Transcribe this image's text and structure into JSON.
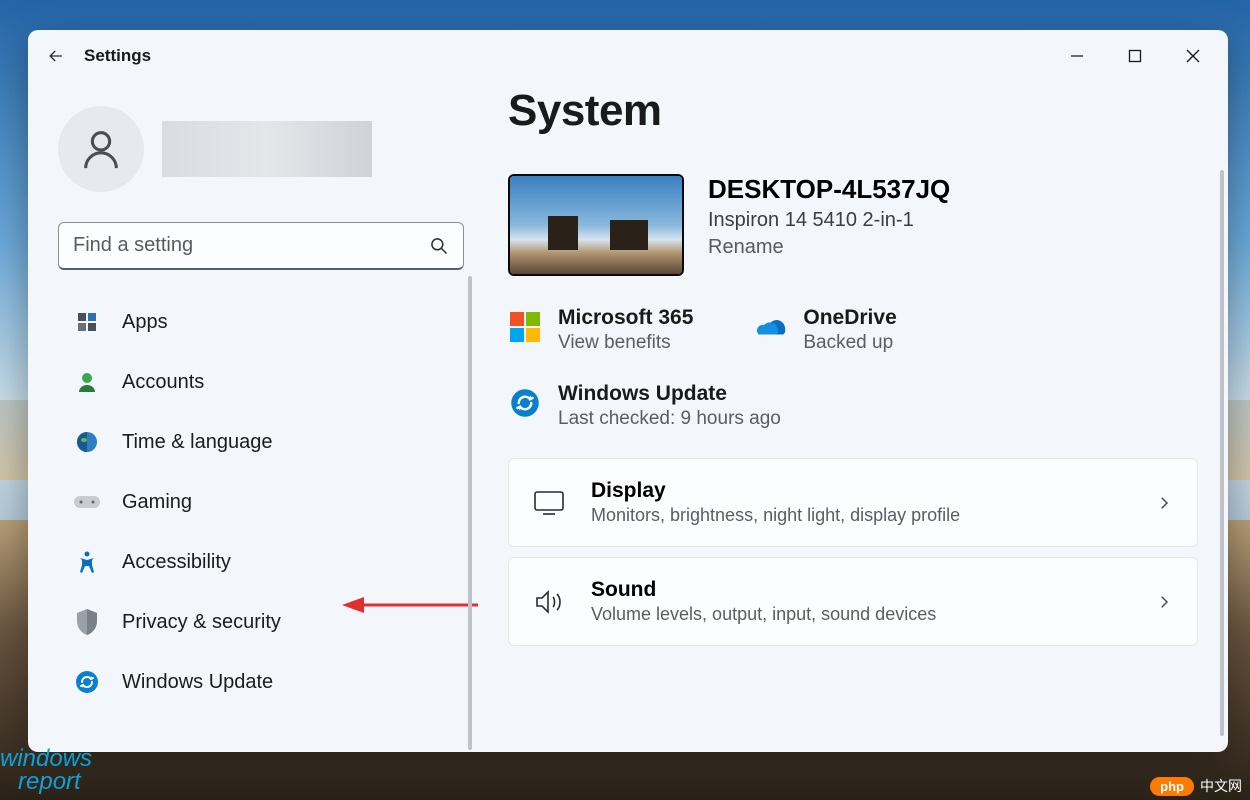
{
  "titlebar": {
    "title": "Settings"
  },
  "search": {
    "placeholder": "Find a setting"
  },
  "sidebar": {
    "items": [
      {
        "label": "Apps",
        "icon": "apps-icon"
      },
      {
        "label": "Accounts",
        "icon": "accounts-icon"
      },
      {
        "label": "Time & language",
        "icon": "time-language-icon"
      },
      {
        "label": "Gaming",
        "icon": "gaming-icon"
      },
      {
        "label": "Accessibility",
        "icon": "accessibility-icon"
      },
      {
        "label": "Privacy & security",
        "icon": "privacy-security-icon"
      },
      {
        "label": "Windows Update",
        "icon": "windows-update-icon"
      }
    ]
  },
  "main": {
    "title": "System",
    "device": {
      "name": "DESKTOP-4L537JQ",
      "model": "Inspiron 14 5410 2-in-1",
      "rename": "Rename"
    },
    "cards": {
      "ms365": {
        "title": "Microsoft 365",
        "sub": "View benefits"
      },
      "onedrive": {
        "title": "OneDrive",
        "sub": "Backed up"
      },
      "update": {
        "title": "Windows Update",
        "sub": "Last checked: 9 hours ago"
      }
    },
    "list": [
      {
        "title": "Display",
        "sub": "Monitors, brightness, night light, display profile"
      },
      {
        "title": "Sound",
        "sub": "Volume levels, output, input, sound devices"
      }
    ]
  },
  "watermark": {
    "left1": "windows",
    "left2": "report",
    "pill": "php",
    "cn": "中文网"
  }
}
